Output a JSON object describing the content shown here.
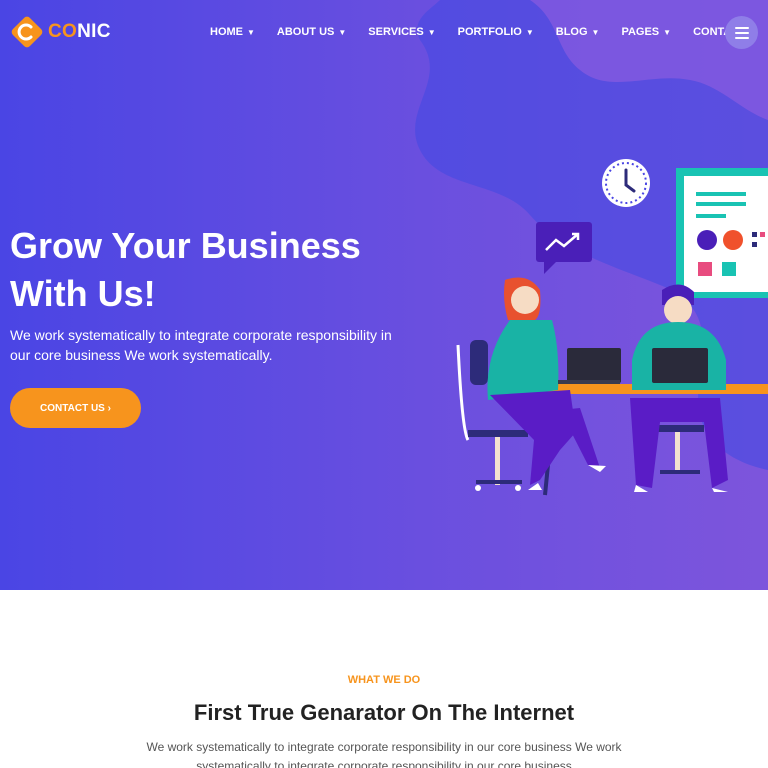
{
  "brand": {
    "name_accent": "CO",
    "name_rest": "NIC"
  },
  "nav": {
    "items": [
      {
        "label": "HOME",
        "dropdown": true
      },
      {
        "label": "ABOUT US",
        "dropdown": true
      },
      {
        "label": "SERVICES",
        "dropdown": true
      },
      {
        "label": "PORTFOLIO",
        "dropdown": true
      },
      {
        "label": "BLOG",
        "dropdown": true
      },
      {
        "label": "PAGES",
        "dropdown": true
      },
      {
        "label": "CONTACT",
        "dropdown": false
      }
    ],
    "menu_icon": "hamburger-icon"
  },
  "hero": {
    "title_line1": "Grow Your Business",
    "title_line2": "With Us!",
    "subtitle": "We work systematically to integrate corporate responsibility in our core business We work systematically.",
    "cta_label": "CONTACT US ›"
  },
  "section": {
    "eyebrow": "WHAT WE DO",
    "title": "First True Genarator On The Internet",
    "text": "We work systematically to integrate corporate responsibility in our core business We work systematically to integrate corporate responsibility in our core business"
  },
  "colors": {
    "hero_gradient_start": "#4a45e4",
    "hero_gradient_end": "#7d55dc",
    "accent": "#f7941d",
    "teal": "#17b3a3"
  }
}
